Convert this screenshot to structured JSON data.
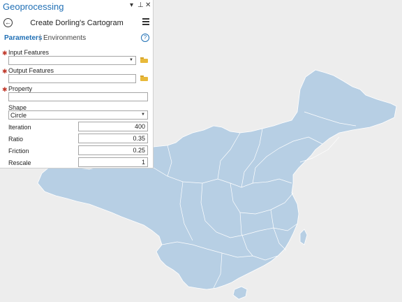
{
  "panel": {
    "title": "Geoprocessing",
    "controls": {
      "dropdown": "▾",
      "pin": "⊥",
      "close": "✕"
    },
    "tool_title": "Create Dorling's Cartogram",
    "tabs": {
      "parameters": "Parameters",
      "separator": "|",
      "environments": "Environments"
    },
    "help": "?"
  },
  "params": {
    "input_features": {
      "label": "Input Features",
      "value": ""
    },
    "output_features": {
      "label": "Output Features",
      "value": ""
    },
    "property": {
      "label": "Property",
      "value": ""
    },
    "shape": {
      "label": "Shape",
      "value": "Circle"
    },
    "iteration": {
      "label": "Iteration",
      "value": "400"
    },
    "ratio": {
      "label": "Ratio",
      "value": "0.35"
    },
    "friction": {
      "label": "Friction",
      "value": "0.25"
    },
    "rescale": {
      "label": "Rescale",
      "value": "1"
    }
  },
  "colors": {
    "accent": "#1f6fb5",
    "map_fill": "#b7cfe4",
    "required": "#c0392b",
    "background": "#ededed"
  }
}
